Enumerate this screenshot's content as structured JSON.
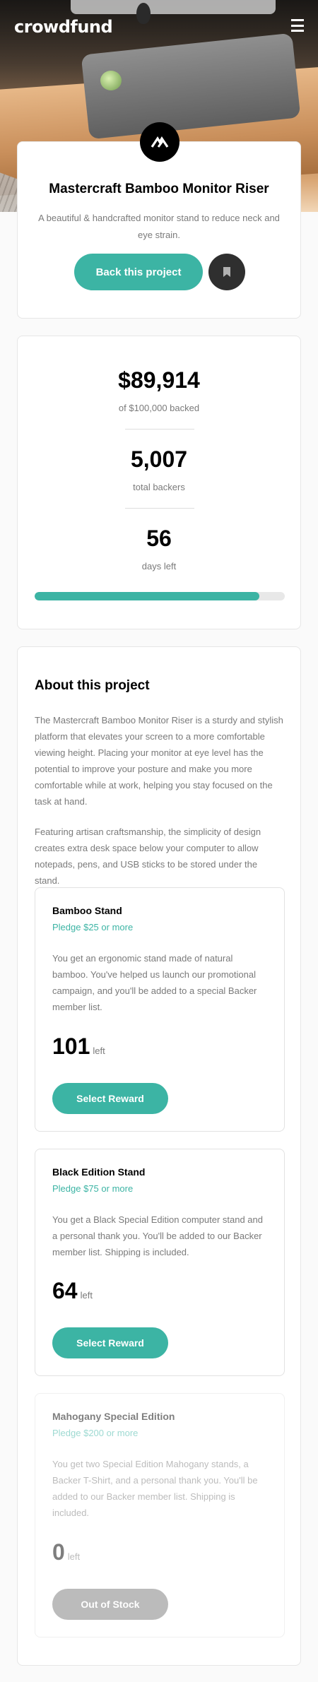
{
  "header": {
    "logo": "crowdfund",
    "menu_icon": "hamburger-icon"
  },
  "colors": {
    "accent": "#3cb4a4",
    "dark_accent": "#147a73",
    "text_gray": "#7a7a7a"
  },
  "project": {
    "title": "Mastercraft Bamboo Monitor Riser",
    "description": "A beautiful & handcrafted monitor stand to reduce neck and eye strain.",
    "back_label": "Back this project",
    "bookmark_icon": "bookmark-icon"
  },
  "stats": {
    "amount": "$89,914",
    "amount_label": "of $100,000 backed",
    "backers": "5,007",
    "backers_label": "total backers",
    "days": "56",
    "days_label": "days left",
    "progress_fraction": 0.899
  },
  "about": {
    "heading": "About this project",
    "paragraph1": "The Mastercraft Bamboo Monitor Riser is a sturdy and stylish platform that elevates your screen to a more comfortable viewing height. Placing your monitor at eye level has the potential to improve your posture and make you more comfortable while at work, helping you stay focused on the task at hand.",
    "paragraph2": "Featuring artisan craftsmanship, the simplicity of design creates extra desk space below your computer to allow notepads, pens, and USB sticks to be stored under the stand."
  },
  "pledges": [
    {
      "name": "Bamboo Stand",
      "min": "Pledge $25 or more",
      "text": "You get an ergonomic stand made of natural bamboo. You've helped us launch our promotional campaign, and you'll be added to a special Backer member list.",
      "count": "101",
      "left_label": "left",
      "button": "Select Reward"
    },
    {
      "name": "Black Edition Stand",
      "min": "Pledge $75 or more",
      "text": "You get a Black Special Edition computer stand and a personal thank you. You'll be added to our Backer member list. Shipping is included.",
      "count": "64",
      "left_label": "left",
      "button": "Select Reward"
    },
    {
      "name": "Mahogany Special Edition",
      "min": "Pledge $200 or more",
      "text": "You get two Special Edition Mahogany stands, a Backer T-Shirt, and a personal thank you. You'll be added to our Backer member list. Shipping is included.",
      "count": "0",
      "left_label": "left",
      "button": "Out of Stock"
    }
  ]
}
